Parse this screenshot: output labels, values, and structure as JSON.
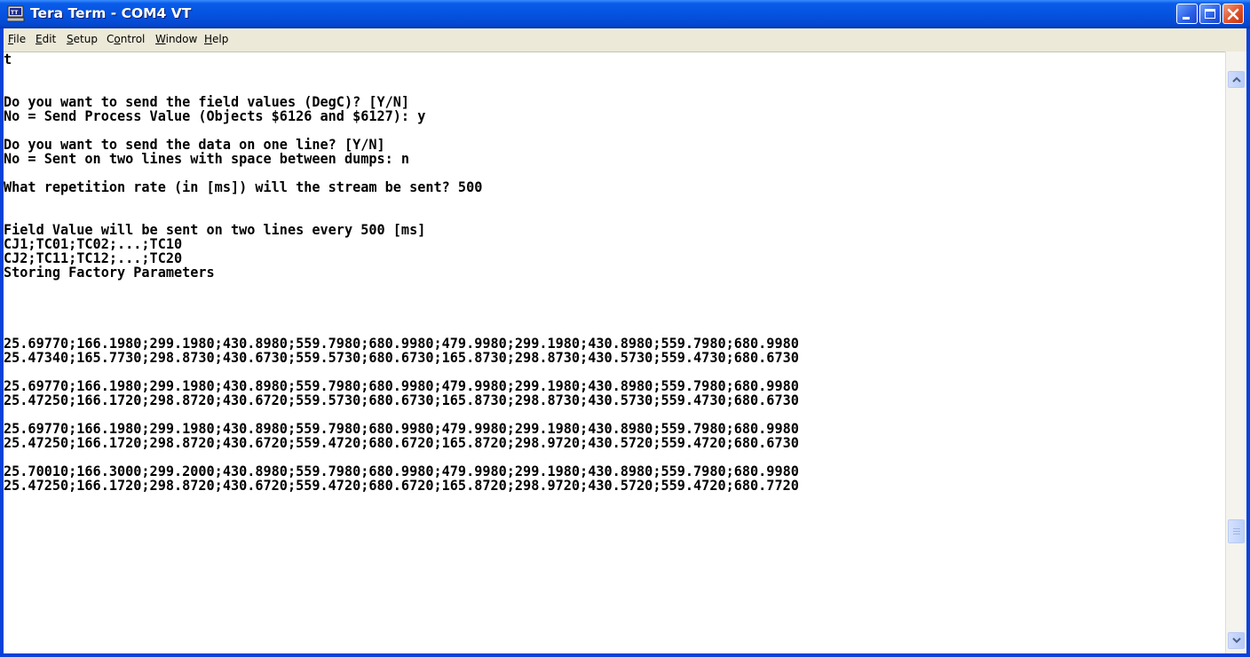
{
  "window": {
    "title": "Tera Term - COM4 VT",
    "icon": "tera-term-terminal-icon"
  },
  "menu": [
    {
      "label": "File",
      "mnemonic": "F",
      "rest": "ile"
    },
    {
      "label": "Edit",
      "mnemonic": "E",
      "rest": "dit"
    },
    {
      "label": "Setup",
      "mnemonic": "S",
      "rest": "etup"
    },
    {
      "label": "Control",
      "mnemonic": "o",
      "pre": "C",
      "rest": "ntrol"
    },
    {
      "label": "Window",
      "mnemonic": "W",
      "rest": "indow"
    },
    {
      "label": "Help",
      "mnemonic": "H",
      "rest": "elp"
    }
  ],
  "terminal": {
    "lines": [
      "t",
      "",
      "",
      "Do you want to send the field values (DegC)? [Y/N]",
      "No = Send Process Value (Objects $6126 and $6127): y",
      "",
      "Do you want to send the data on one line? [Y/N]",
      "No = Sent on two lines with space between dumps: n",
      "",
      "What repetition rate (in [ms]) will the stream be sent? 500",
      "",
      "",
      "Field Value will be sent on two lines every 500 [ms]",
      "CJ1;TC01;TC02;...;TC10",
      "CJ2;TC11;TC12;...;TC20",
      "Storing Factory Parameters",
      "",
      "",
      "",
      "",
      "25.69770;166.1980;299.1980;430.8980;559.7980;680.9980;479.9980;299.1980;430.8980;559.7980;680.9980",
      "25.47340;165.7730;298.8730;430.6730;559.5730;680.6730;165.8730;298.8730;430.5730;559.4730;680.6730",
      "",
      "25.69770;166.1980;299.1980;430.8980;559.7980;680.9980;479.9980;299.1980;430.8980;559.7980;680.9980",
      "25.47250;166.1720;298.8720;430.6720;559.5730;680.6730;165.8730;298.8730;430.5730;559.4730;680.6730",
      "",
      "25.69770;166.1980;299.1980;430.8980;559.7980;680.9980;479.9980;299.1980;430.8980;559.7980;680.9980",
      "25.47250;166.1720;298.8720;430.6720;559.4720;680.6720;165.8720;298.9720;430.5720;559.4720;680.6730",
      "",
      "25.70010;166.3000;299.2000;430.8980;559.7980;680.9980;479.9980;299.1980;430.8980;559.7980;680.9980",
      "25.47250;166.1720;298.8720;430.6720;559.4720;680.6720;165.8720;298.9720;430.5720;559.4720;680.7720"
    ]
  },
  "scrollbar": {
    "up_icon": "scroll-up-arrow-icon",
    "down_icon": "scroll-down-arrow-icon",
    "position": 0.83
  },
  "colors": {
    "titlebar": "#0553e0",
    "menubar": "#ece9d8",
    "terminal_bg": "#ffffff",
    "terminal_fg": "#000000",
    "close_button": "#e0502a"
  }
}
